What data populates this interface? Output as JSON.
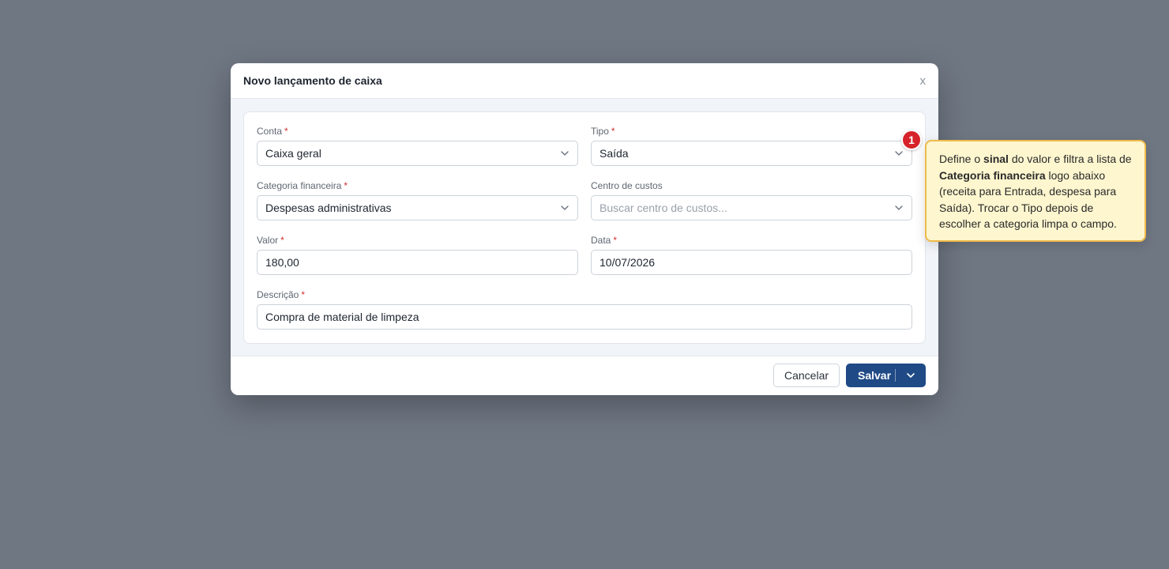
{
  "modal": {
    "title": "Novo lançamento de caixa",
    "close_label": "x"
  },
  "form": {
    "conta": {
      "label": "Conta",
      "required": "*",
      "value": "Caixa geral"
    },
    "tipo": {
      "label": "Tipo",
      "required": "*",
      "value": "Saída"
    },
    "categoria": {
      "label": "Categoria financeira",
      "required": "*",
      "value": "Despesas administrativas"
    },
    "centro_custos": {
      "label": "Centro de custos",
      "placeholder": "Buscar centro de custos..."
    },
    "valor": {
      "label": "Valor",
      "required": "*",
      "value": "180,00"
    },
    "data": {
      "label": "Data",
      "required": "*",
      "value": "10/07/2026"
    },
    "descricao": {
      "label": "Descrição",
      "required": "*",
      "value": "Compra de material de limpeza"
    }
  },
  "footer": {
    "cancel_label": "Cancelar",
    "save_label": "Salvar"
  },
  "tour": {
    "step_number": "1",
    "text_1": "Define o ",
    "bold_1": "sinal",
    "text_2": " do valor e filtra a lista de ",
    "bold_2": "Categoria financeira",
    "text_3": " logo abaixo (receita para Entrada, despesa para Saída). Trocar o Tipo depois de escolher a categoria limpa o campo."
  },
  "colors": {
    "overlay": "#6f7783",
    "primary": "#1f4a86",
    "required": "#d32f2f",
    "badge": "#d6222a",
    "tooltip_bg": "#fdf6cf",
    "tooltip_border": "#efba4a"
  },
  "icons": {
    "dropdown": "chevron-down-icon",
    "close": "close-icon"
  }
}
